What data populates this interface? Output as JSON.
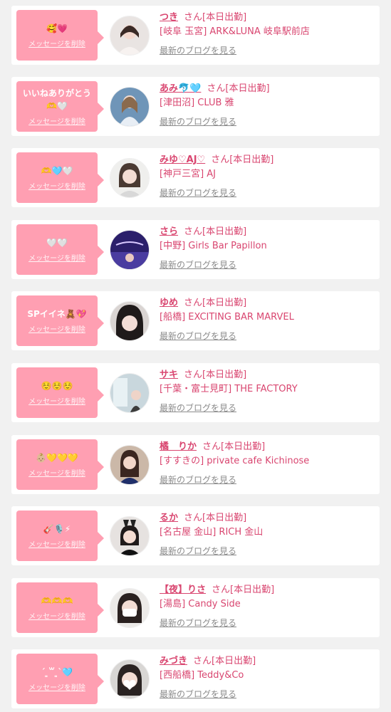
{
  "cards": [
    {
      "message": "🥰💗",
      "delete_label": "メッセージを削除",
      "name": "つき",
      "suffix": "さん[本日出勤]",
      "shop": "[岐阜 玉宮] ARK&LUNA 岐阜駅前店",
      "blog_label": "最新のブログを見る",
      "avatar": "avatar-woman-light"
    },
    {
      "message": "いいねありがとう🫶🤍",
      "delete_label": "メッセージを削除",
      "name": "あみ🐬🩵",
      "suffix": "さん[本日出勤]",
      "shop": "[津田沼] CLUB 雅",
      "blog_label": "最新のブログを見る",
      "avatar": "avatar-woman-blue"
    },
    {
      "message": "🫶🩵🤍",
      "delete_label": "メッセージを削除",
      "name": "みゆ♡AJ♡",
      "suffix": "さん[本日出勤]",
      "shop": "[神戸三宮] AJ",
      "blog_label": "最新のブログを見る",
      "avatar": "avatar-woman-bob"
    },
    {
      "message": "🤍🤍",
      "delete_label": "メッセージを削除",
      "name": "さら",
      "suffix": "さん[本日出勤]",
      "shop": "[中野] Girls Bar Papillon",
      "blog_label": "最新のブログを見る",
      "avatar": "avatar-papillon"
    },
    {
      "message": "SPイイネ🧸💖",
      "delete_label": "メッセージを削除",
      "name": "ゆめ",
      "suffix": "さん[本日出勤]",
      "shop": "[船橋] EXCITING BAR MARVEL",
      "blog_label": "最新のブログを見る",
      "avatar": "avatar-woman-dark"
    },
    {
      "message": "☺️☺️☺️",
      "delete_label": "メッセージを削除",
      "name": "サキ",
      "suffix": "さん[本日出勤]",
      "shop": "[千葉・富士見町] THE FACTORY",
      "blog_label": "最新のブログを見る",
      "avatar": "avatar-woman-window"
    },
    {
      "message": "👶🏼💛💛💛",
      "delete_label": "メッセージを削除",
      "name": "橘　りか",
      "suffix": "さん[本日出勤]",
      "shop": "[すすきの] private cafe Kichinose",
      "blog_label": "最新のブログを見る",
      "avatar": "avatar-woman-navy"
    },
    {
      "message": "🎸🎙️⚡",
      "delete_label": "メッセージを削除",
      "name": "るか",
      "suffix": "さん[本日出勤]",
      "shop": "[名古屋 金山] RICH 金山",
      "blog_label": "最新のブログを見る",
      "avatar": "avatar-woman-bunny"
    },
    {
      "message": "🫶🫶🫶",
      "delete_label": "メッセージを削除",
      "name": "【夜】りさ",
      "suffix": "さん[本日出勤]",
      "shop": "[湯島] Candy Side",
      "blog_label": "最新のブログを見る",
      "avatar": "avatar-woman-mask"
    },
    {
      "message": "ˊ ͈꒳ ͈ˋ🩵",
      "delete_label": "メッセージを削除",
      "name": "みづき",
      "suffix": "さん[本日出勤]",
      "shop": "[西船橋] Teddy&Co",
      "blog_label": "最新のブログを見る",
      "avatar": "avatar-woman-heart"
    }
  ],
  "colors": {
    "bubble": "#ff9fb2",
    "name": "#d94670",
    "shop": "#d94670",
    "blog": "#8b8b8b",
    "background": "#f1f1f1"
  }
}
